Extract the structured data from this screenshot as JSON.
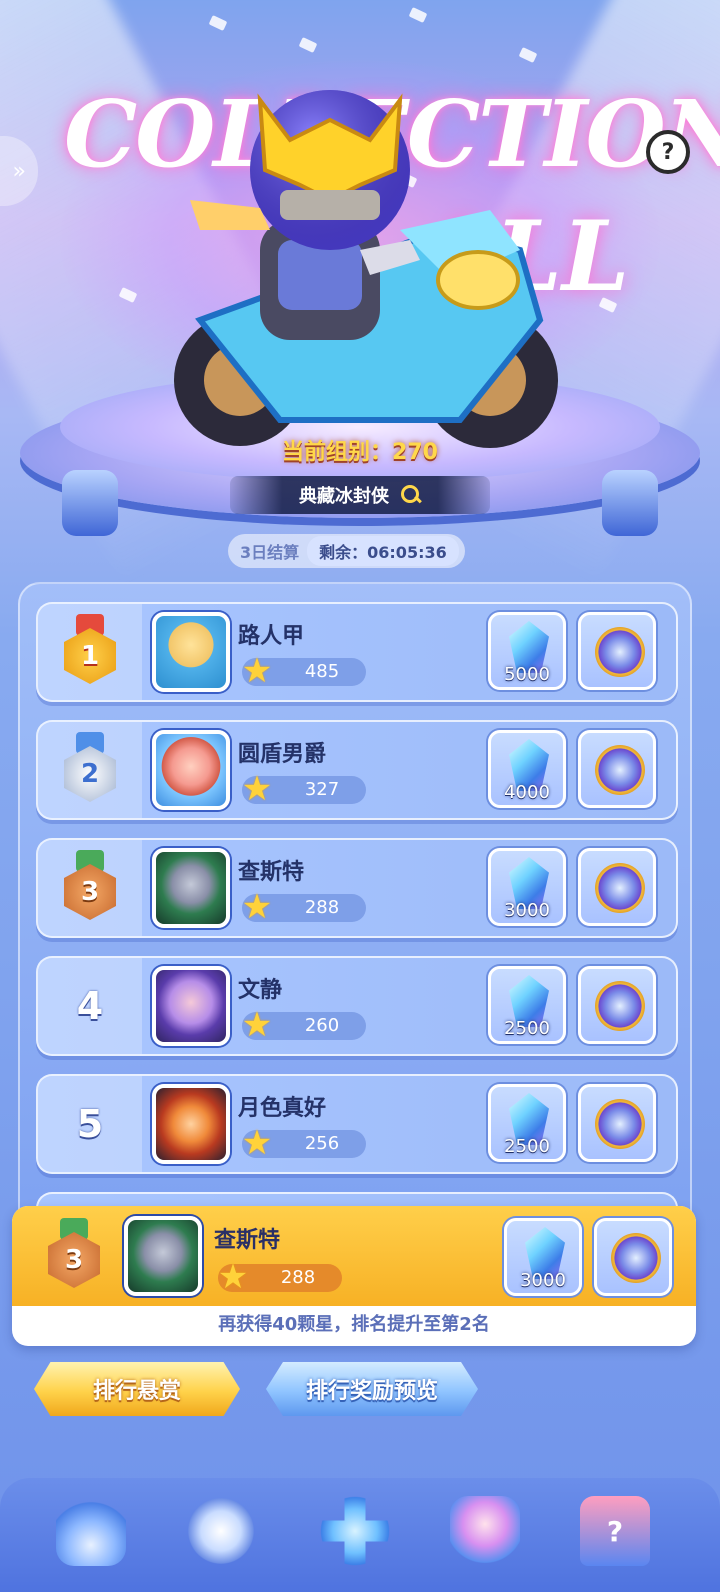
{
  "hero": {
    "title_line1": "COLLECTION",
    "title_line2": "ALL",
    "group_label": "当前组别：270",
    "character_name": "典藏冰封侠",
    "help_label": "?"
  },
  "timer": {
    "cycle": "3日结算",
    "remaining": "剩余：06:05:36"
  },
  "ranking": [
    {
      "rank": "1",
      "name": "路人甲",
      "stars": "485",
      "gem_reward": "5000",
      "medal": "gold"
    },
    {
      "rank": "2",
      "name": "圆盾男爵",
      "stars": "327",
      "gem_reward": "4000",
      "medal": "silver"
    },
    {
      "rank": "3",
      "name": "查斯特",
      "stars": "288",
      "gem_reward": "3000",
      "medal": "bronze"
    },
    {
      "rank": "4",
      "name": "文静",
      "stars": "260",
      "gem_reward": "2500",
      "medal": ""
    },
    {
      "rank": "5",
      "name": "月色真好",
      "stars": "256",
      "gem_reward": "2500",
      "medal": ""
    }
  ],
  "self": {
    "rank": "3",
    "name": "查斯特",
    "stars": "288",
    "gem_reward": "3000",
    "hint": "再获得40颗星，排名提升至第2名"
  },
  "buttons": {
    "bounty": "排行悬赏",
    "preview": "排行奖励预览"
  },
  "nav": [
    "trophy-arrow-icon",
    "whistle-icon",
    "dpad-icon",
    "trophy-icon",
    "slot-machine-icon"
  ],
  "colors": {
    "self_bar": "#f7b125",
    "accent_gold": "#ffd84a"
  }
}
